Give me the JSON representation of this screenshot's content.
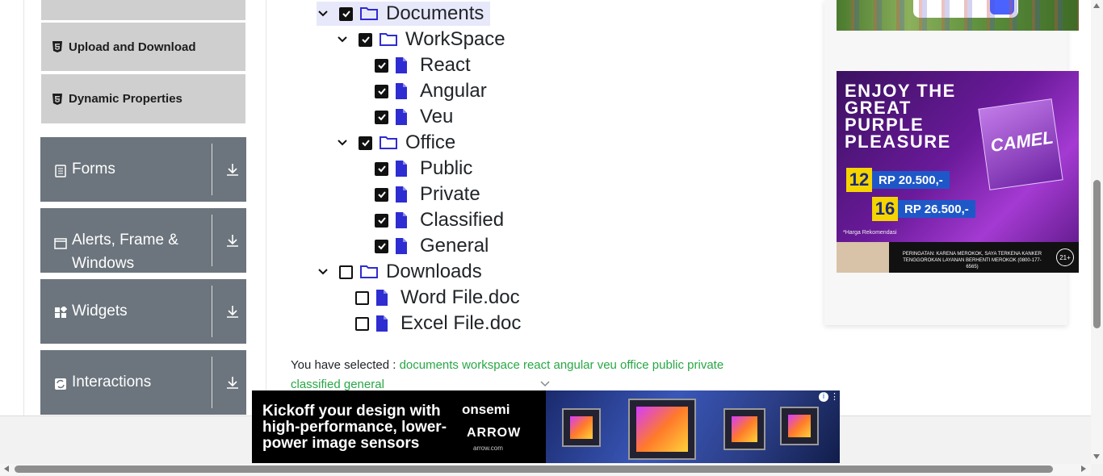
{
  "sidebar": {
    "sub_items": [
      {
        "label": "Upload and Download"
      },
      {
        "label": "Dynamic Properties"
      }
    ],
    "groups": [
      {
        "label": "Forms",
        "icon": "form-icon"
      },
      {
        "label": "Alerts, Frame & Windows",
        "icon": "window-icon"
      },
      {
        "label": "Widgets",
        "icon": "widgets-icon"
      },
      {
        "label": "Interactions",
        "icon": "interactions-icon"
      }
    ]
  },
  "tree": {
    "documents": "Documents",
    "workspace": "WorkSpace",
    "react": "React",
    "angular": "Angular",
    "veu": "Veu",
    "office": "Office",
    "public": "Public",
    "private": "Private",
    "classified": "Classified",
    "general": "General",
    "downloads": "Downloads",
    "word": "Word File.doc",
    "excel": "Excel File.doc"
  },
  "result": {
    "prefix": "You have selected :",
    "items": "documents workspace react angular veu office public private classified general"
  },
  "ads": {
    "camel_headline": "ENJOY THE GREAT PURPLE PLEASURE",
    "camel_brand": "CAMEL",
    "camel_price1_sticks": "12",
    "camel_price1": "RP 20.500,-",
    "camel_price2_sticks": "16",
    "camel_price2": "RP 26.500,-",
    "camel_note": "*Harga Rekomendasi",
    "camel_warning": "PERINGATAN: KARENA MEROKOK, SAYA TERKENA KANKER TENGGOROKAN LAYANAN BERHENTI MEROKOK (0800-177-6565)",
    "camel_age": "21+",
    "bottom_copy": "Kickoff your design with high-performance, lower-power image sensors",
    "bottom_brand1": "onsemi",
    "bottom_brand2": "ARROW",
    "bottom_brand3": "arrow.com"
  },
  "colors": {
    "sidebar_group": "#6c757d",
    "sidebar_sub": "#cfcfcf",
    "selected_text": "#28a745",
    "icon_blue": "#2d2dd1"
  }
}
